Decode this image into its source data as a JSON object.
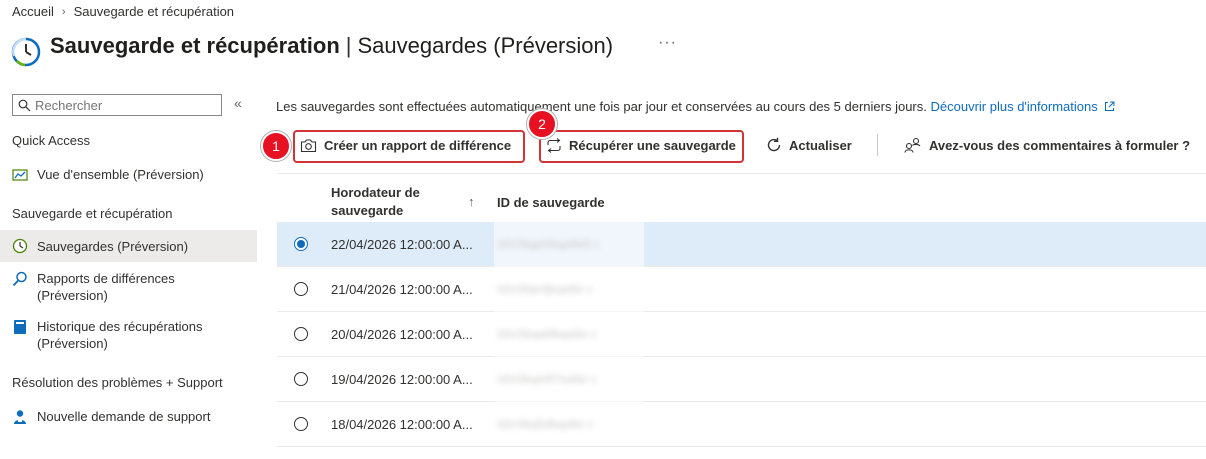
{
  "breadcrumb": {
    "home": "Accueil",
    "current": "Sauvegarde et récupération"
  },
  "header": {
    "title": "Sauvegarde et récupération",
    "subtitle": "Sauvegardes (Préversion)",
    "more": "···"
  },
  "sidebar": {
    "search_placeholder": "Rechercher",
    "collapse": "«",
    "sections": [
      {
        "title": "Quick Access"
      },
      {
        "title": "Sauvegarde et récupération"
      },
      {
        "title": "Résolution des problèmes + Support"
      }
    ],
    "items": [
      {
        "label": "Vue d'ensemble (Préversion)",
        "icon": "overview-icon"
      },
      {
        "label": "Sauvegardes (Préversion)",
        "icon": "clock-icon",
        "active": true
      },
      {
        "label": "Rapports de différences (Préversion)",
        "icon": "search-report-icon"
      },
      {
        "label": "Historique des récupérations (Préversion)",
        "icon": "history-book-icon"
      },
      {
        "label": "Nouvelle demande de support",
        "icon": "support-person-icon"
      }
    ]
  },
  "main": {
    "description": "Les sauvegardes sont effectuées automatiquement une fois par jour et conservées au cours des 5 derniers jours.",
    "learn_more": "Découvrir plus d'informations",
    "toolbar": {
      "create_diff": "Créer un rapport de différence",
      "restore": "Récupérer une sauvegarde",
      "refresh": "Actualiser",
      "feedback": "Avez-vous des commentaires à formuler ?"
    },
    "badges": {
      "one": "1",
      "two": "2"
    },
    "columns": {
      "timestamp": "Horodateur de sauvegarde",
      "sort": "↑",
      "backup_id": "ID de sauvegarde"
    },
    "rows": [
      {
        "timestamp": "22/04/2026 12:00:00 A...",
        "id": "b0c0bge0bqa9e6 c",
        "selected": true
      },
      {
        "timestamp": "21/04/2026 12:00:00 A...",
        "id": "b0c0fqe4jbqa6e c",
        "selected": false
      },
      {
        "timestamp": "20/04/2026 12:00:00 A...",
        "id": "b0c0bqa6fbqa6e c",
        "selected": false
      },
      {
        "timestamp": "19/04/2026 12:00:00 A...",
        "id": "b0c0bqe8f7ea6e c",
        "selected": false
      },
      {
        "timestamp": "18/04/2026 12:00:00 A...",
        "id": "b0c0bq5dbqa6e c",
        "selected": false
      }
    ]
  },
  "colors": {
    "accent": "#0f6cbd",
    "highlight": "#d13438",
    "selected_row": "#deecf9",
    "active_nav": "#edebe9"
  }
}
